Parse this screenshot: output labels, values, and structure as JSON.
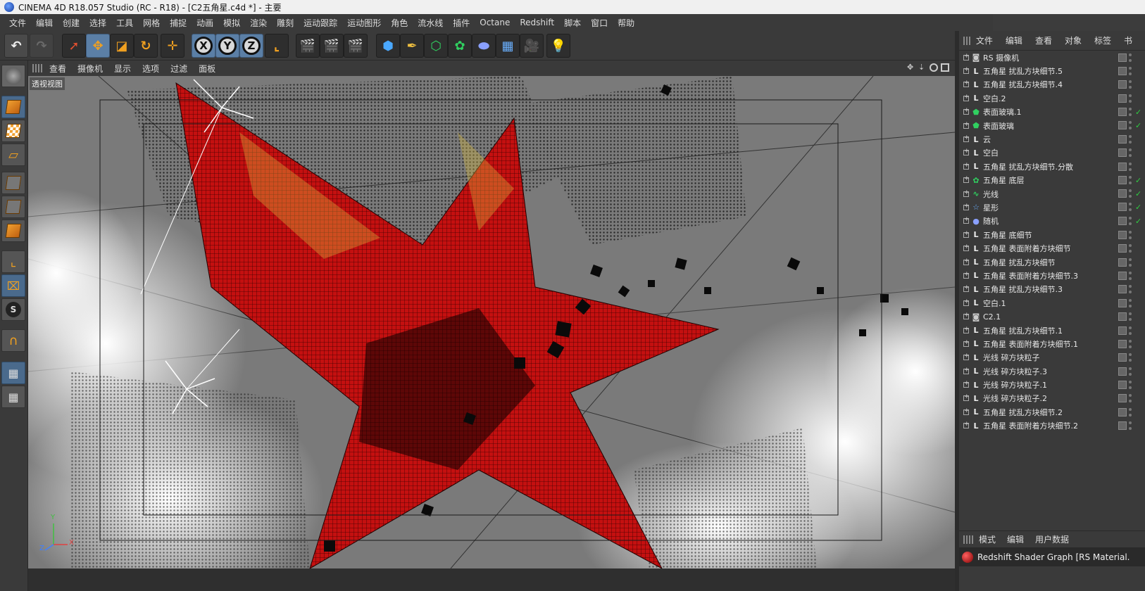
{
  "window": {
    "title": "CINEMA 4D R18.057 Studio (RC - R18) - [C2五角星.c4d *] - 主要"
  },
  "menu": [
    "文件",
    "编辑",
    "创建",
    "选择",
    "工具",
    "网格",
    "捕捉",
    "动画",
    "模拟",
    "渲染",
    "雕刻",
    "运动跟踪",
    "运动图形",
    "角色",
    "流水线",
    "插件",
    "Octane",
    "Redshift",
    "脚本",
    "窗口",
    "帮助"
  ],
  "toolbar": {
    "axis_x": "X",
    "axis_y": "Y",
    "axis_z": "Z"
  },
  "viewport_menu": [
    "查看",
    "摄像机",
    "显示",
    "选项",
    "过滤",
    "面板"
  ],
  "viewport": {
    "label": "透视视图",
    "axis_y": "Y",
    "axis_z": "Z",
    "axis_x": "X"
  },
  "object_panel_menu": [
    "文件",
    "编辑",
    "查看",
    "对象",
    "标签",
    "书"
  ],
  "objects": [
    {
      "name": "RS 摄像机",
      "icon": "camera-icon",
      "check": ""
    },
    {
      "name": "五角星 扰乱方块细节.5",
      "icon": "null-icon",
      "check": ""
    },
    {
      "name": "五角星 扰乱方块细节.4",
      "icon": "null-icon",
      "check": ""
    },
    {
      "name": "空白.2",
      "icon": "null-icon",
      "check": ""
    },
    {
      "name": "表面玻璃.1",
      "icon": "emitter-icon",
      "check": "✓"
    },
    {
      "name": "表面玻璃",
      "icon": "emitter-icon",
      "check": "✓"
    },
    {
      "name": "云",
      "icon": "null-icon",
      "check": ""
    },
    {
      "name": "空白",
      "icon": "null-icon",
      "check": ""
    },
    {
      "name": "五角星 扰乱方块细节.分散",
      "icon": "null-icon",
      "check": ""
    },
    {
      "name": "五角星 底层",
      "icon": "cloner-icon",
      "check": "✓"
    },
    {
      "name": "光线",
      "icon": "spline-icon",
      "check": "✓"
    },
    {
      "name": "星形",
      "icon": "star-icon",
      "check": "✓"
    },
    {
      "name": "随机",
      "icon": "random-icon",
      "check": "✓"
    },
    {
      "name": "五角星 底细节",
      "icon": "null-icon",
      "check": ""
    },
    {
      "name": "五角星 表面附着方块细节",
      "icon": "null-icon",
      "check": ""
    },
    {
      "name": "五角星 扰乱方块细节",
      "icon": "null-icon",
      "check": ""
    },
    {
      "name": "五角星 表面附着方块细节.3",
      "icon": "null-icon",
      "check": ""
    },
    {
      "name": "五角星 扰乱方块细节.3",
      "icon": "null-icon",
      "check": ""
    },
    {
      "name": "空白.1",
      "icon": "null-icon",
      "check": ""
    },
    {
      "name": "C2.1",
      "icon": "camera-icon",
      "check": ""
    },
    {
      "name": "五角星 扰乱方块细节.1",
      "icon": "null-icon",
      "check": ""
    },
    {
      "name": "五角星 表面附着方块细节.1",
      "icon": "null-icon",
      "check": ""
    },
    {
      "name": "光线 碎方块粒子",
      "icon": "null-icon",
      "check": ""
    },
    {
      "name": "光线 碎方块粒子.3",
      "icon": "null-icon",
      "check": ""
    },
    {
      "name": "光线 碎方块粒子.1",
      "icon": "null-icon",
      "check": ""
    },
    {
      "name": "光线 碎方块粒子.2",
      "icon": "null-icon",
      "check": ""
    },
    {
      "name": "五角星 扰乱方块细节.2",
      "icon": "null-icon",
      "check": ""
    },
    {
      "name": "五角星 表面附着方块细节.2",
      "icon": "null-icon",
      "check": ""
    }
  ],
  "attr_menu": [
    "模式",
    "编辑",
    "用户数据"
  ],
  "attr_title": "Redshift Shader Graph [RS Material.",
  "colors": {
    "accent_blue": "#5b7fa6",
    "star_red": "#c81010",
    "check_green": "#2ecc40"
  }
}
